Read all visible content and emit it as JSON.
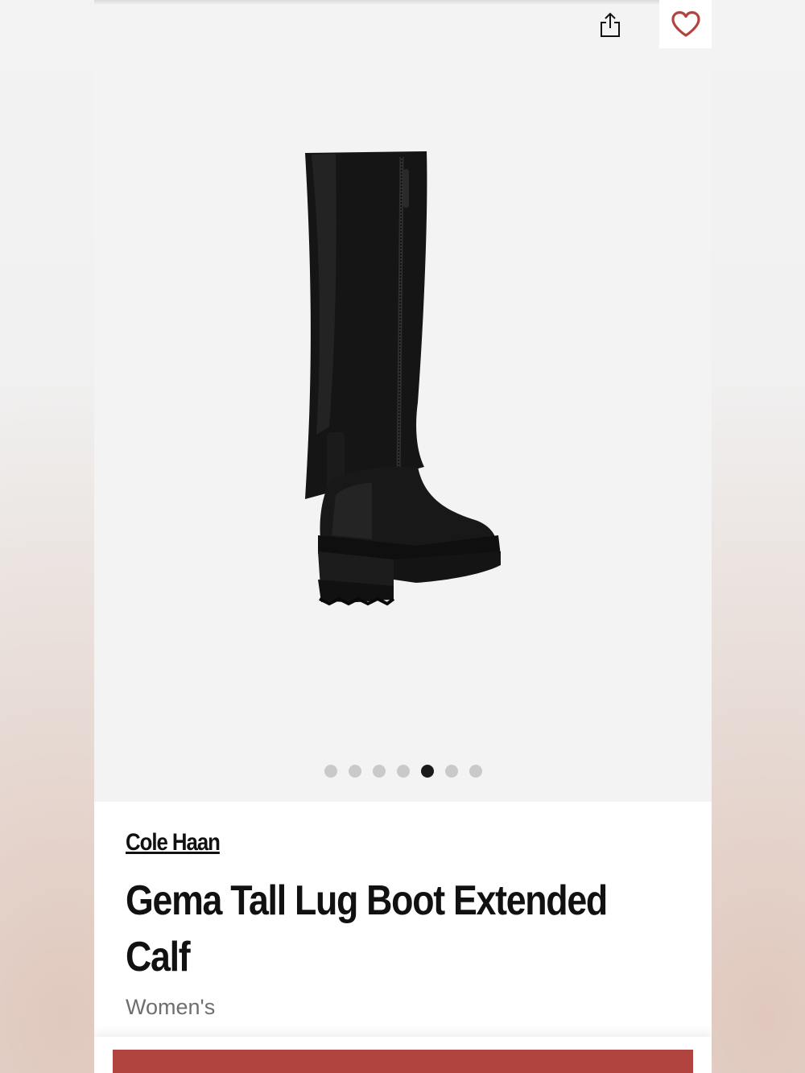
{
  "header": {
    "share_icon": "share-icon",
    "favorite_icon": "heart-icon",
    "favorite_color": "#b24440"
  },
  "carousel": {
    "dot_count": 7,
    "active_index": 4
  },
  "product": {
    "brand": "Cole Haan",
    "title": "Gema Tall Lug Boot Extended Calf",
    "gender": "Women's"
  },
  "colors": {
    "accent": "#b24440",
    "text": "#111111",
    "muted": "#6e6e6e"
  }
}
